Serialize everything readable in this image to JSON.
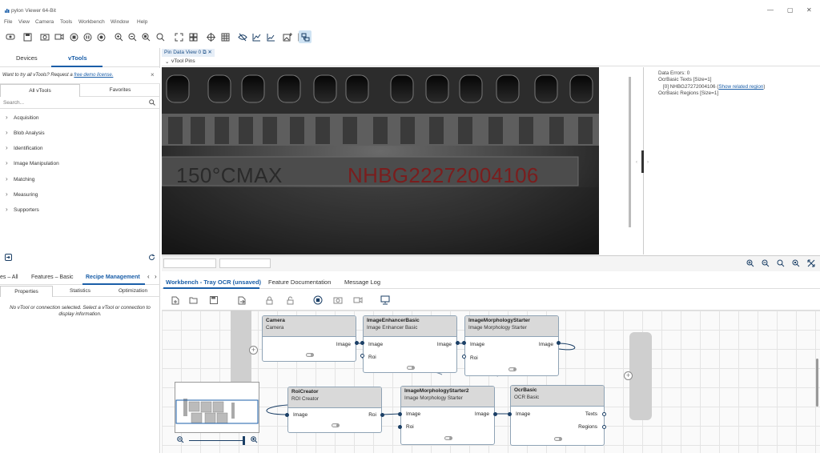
{
  "window": {
    "title": "pylon Viewer 64-Bit",
    "controls": {
      "minimize": "—",
      "restore": "▢",
      "close": "✕"
    }
  },
  "menu": [
    "File",
    "View",
    "Camera",
    "Tools",
    "Workbench",
    "Window",
    "Help"
  ],
  "left_panel": {
    "tabs": [
      "Devices",
      "vTools"
    ],
    "license_prefix": "Want to try all vTools? Request a ",
    "license_link": "free demo license.",
    "subtabs": [
      "All vTools",
      "Favorites"
    ],
    "search_placeholder": "Search...",
    "categories": [
      "Acquisition",
      "Blob Analysis",
      "Identification",
      "Image Manipulation",
      "Matching",
      "Measuring",
      "Supporters"
    ],
    "lower_tabs": [
      "es – All",
      "Features – Basic",
      "Recipe Management"
    ],
    "lower_subtabs": [
      "Properties",
      "Statistics",
      "Optimization"
    ],
    "no_selection": "No vTool or connection selected. Select a vTool or connection to display information."
  },
  "pin_view": {
    "tab_label": "Pin Data View 0",
    "bar_label": "vTool Pins",
    "image_text_left": "150°CMAX",
    "image_text_right": "NHBG22272004106",
    "stats": {
      "errors": "Data Errors: 0",
      "texts_header": "OcrBasic Texts [Size=1]",
      "text_value": "[0]  NHBG27272004106",
      "related_link": "Show related region",
      "regions": "OcrBasic Regions [Size=1]"
    }
  },
  "workbench": {
    "tabs": [
      "Workbench - Tray OCR (unsaved)",
      "Feature Documentation",
      "Message Log"
    ],
    "nodes": [
      {
        "name": "Camera",
        "type": "Camera",
        "outputs": [
          "Image"
        ],
        "inputs": []
      },
      {
        "name": "ImageEnhancerBasic",
        "type": "Image Enhancer Basic",
        "inputs": [
          "Image",
          "Roi"
        ],
        "outputs": [
          "Image"
        ]
      },
      {
        "name": "ImageMorphologyStarter",
        "type": "Image Morphology Starter",
        "inputs": [
          "Image",
          "Roi"
        ],
        "outputs": [
          "Image"
        ]
      },
      {
        "name": "RoiCreator",
        "type": "ROI Creator",
        "inputs": [
          "Image"
        ],
        "outputs": [
          "Roi"
        ]
      },
      {
        "name": "ImageMorphologyStarter2",
        "type": "Image Morphology Starter",
        "inputs": [
          "Image",
          "Roi"
        ],
        "outputs": [
          "Image"
        ]
      },
      {
        "name": "OcrBasic",
        "type": "OCR Basic",
        "inputs": [
          "Image"
        ],
        "outputs": [
          "Texts",
          "Regions"
        ]
      }
    ]
  },
  "colors": {
    "accent": "#1a5ea8",
    "node_header": "#d9d9d9",
    "port": "#1b3f66",
    "ocr_text": "#7a1d1d"
  }
}
